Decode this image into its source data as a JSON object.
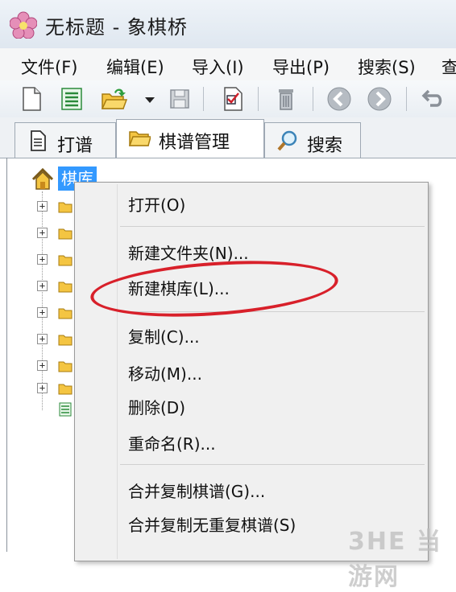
{
  "window": {
    "title": "无标题 - 象棋桥"
  },
  "menu": [
    "文件(F)",
    "编辑(E)",
    "导入(I)",
    "导出(P)",
    "搜索(S)",
    "查"
  ],
  "toolbar": {
    "icons": [
      "new-file-icon",
      "list-icon",
      "open-folder-icon",
      "dropdown-arrow-icon",
      "save-icon",
      "checklist-icon",
      "delete-icon",
      "back-icon",
      "forward-icon",
      "undo-icon"
    ]
  },
  "tabs": [
    {
      "label": "打谱",
      "icon": "document-icon",
      "active": false
    },
    {
      "label": "棋谱管理",
      "icon": "folder-icon",
      "active": true
    },
    {
      "label": "搜索",
      "icon": "magnifier-icon",
      "active": false
    }
  ],
  "tree": {
    "root_label": "棋库"
  },
  "context_menu": {
    "group1": [
      "打开(O)"
    ],
    "group2": [
      "新建文件夹(N)...",
      "新建棋库(L)..."
    ],
    "group3": [
      "复制(C)...",
      "移动(M)...",
      "删除(D)",
      "重命名(R)..."
    ],
    "group4": [
      "合并复制棋谱(G)...",
      "合并复制无重复棋谱(S)"
    ],
    "highlighted": "新建棋库(L)..."
  },
  "watermark": {
    "text": "3HE 当游网"
  },
  "colors": {
    "selection": "#3399ff",
    "annotation_circle": "#d8202a"
  }
}
